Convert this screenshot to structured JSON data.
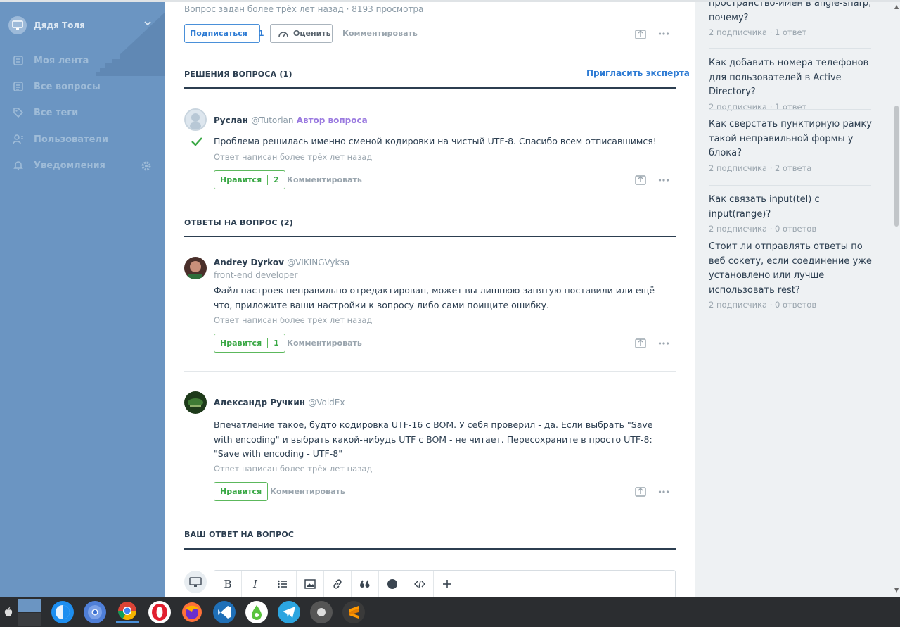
{
  "sidebar": {
    "user_name": "Дядя Толя",
    "items": [
      {
        "label": "Моя лента",
        "icon": "feed-icon"
      },
      {
        "label": "Все вопросы",
        "icon": "questions-icon"
      },
      {
        "label": "Все теги",
        "icon": "tag-icon"
      },
      {
        "label": "Пользователи",
        "icon": "users-icon"
      },
      {
        "label": "Уведомления",
        "icon": "bell-icon"
      }
    ]
  },
  "question": {
    "meta": "Вопрос задан более трёх лет назад · 8193 просмотра",
    "subscribe_label": "Подписаться",
    "subscribe_count": "1",
    "rate_label": "Оценить",
    "comment_label": "Комментировать"
  },
  "solutions": {
    "title": "РЕШЕНИЯ ВОПРОСА (1)",
    "invite_label": "Пригласить эксперта",
    "items": [
      {
        "author": "Руслан",
        "nick": "@Tutorian",
        "badge": "Автор вопроса",
        "text": "Проблема решилась именно сменой кодировки на чистый UTF-8. Спасибо всем отписавшимся!",
        "time": "Ответ написан более трёх лет назад",
        "like_label": "Нравится",
        "like_count": "2",
        "comment_label": "Комментировать"
      }
    ]
  },
  "answers": {
    "title": "ОТВЕТЫ НА ВОПРОС (2)",
    "items": [
      {
        "author": "Andrey Dyrkov",
        "nick": "@VIKINGVyksa",
        "role": "front-end developer",
        "text": "Файл настроек неправильно отредактирован, может вы лишнюю запятую поставили или ещё что, приложите ваши настройки к вопросу либо сами поищите ошибку.",
        "time": "Ответ написан более трёх лет назад",
        "like_label": "Нравится",
        "like_count": "1",
        "comment_label": "Комментировать"
      },
      {
        "author": "Александр Ручкин",
        "nick": "@VoidEx",
        "text": "Впечатление такое, будто кодировка UTF-16 с BOM. У себя проверил - да. Если выбрать \"Save with encoding\" и выбрать какой-нибудь UTF с BOM - не читает. Пересохраните в просто UTF-8: \"Save with encoding - UTF-8\"",
        "time": "Ответ написан более трёх лет назад",
        "like_label": "Нравится",
        "comment_label": "Комментировать"
      }
    ]
  },
  "your_answer": {
    "title": "ВАШ ОТВЕТ НА ВОПРОС",
    "toolbar": [
      "B",
      "I",
      "list",
      "image",
      "link",
      "quote",
      "spoiler",
      "code",
      "+"
    ]
  },
  "related": [
    {
      "title": "пространство-имен в angle-sharp, почему?",
      "meta": "2 подписчика · 1 ответ"
    },
    {
      "title": "Как добавить номера телефонов для пользователей в Active Directory?",
      "meta": "2 подписчика · 1 ответ"
    },
    {
      "title": "Как сверстать пунктирную рамку такой неправильной формы у блока?",
      "meta": "2 подписчика · 2 ответа"
    },
    {
      "title": "Как связать input(tel) с input(range)?",
      "meta": "2 подписчика · 0 ответов"
    },
    {
      "title": "Стоит ли отправлять ответы по веб сокету, если соединение уже установлено или лучше использовать rest?",
      "meta": "2 подписчика · 0 ответов"
    }
  ],
  "taskbar": {
    "apps": [
      "apple-icon",
      "desktop-switcher-icon",
      "finder-icon",
      "chromium-icon",
      "chrome-icon",
      "opera-icon",
      "firefox-icon",
      "vscode-icon",
      "app-green-icon",
      "telegram-icon",
      "app-gray-icon",
      "sublime-icon"
    ]
  },
  "colors": {
    "sidebar_bg": "#6b95c2",
    "accent_blue": "#2f7cd4",
    "like_green": "#3aa845",
    "author_badge": "#9b7be0",
    "right_bg": "#eef1f3",
    "taskbar_bg": "#2b2d30"
  }
}
